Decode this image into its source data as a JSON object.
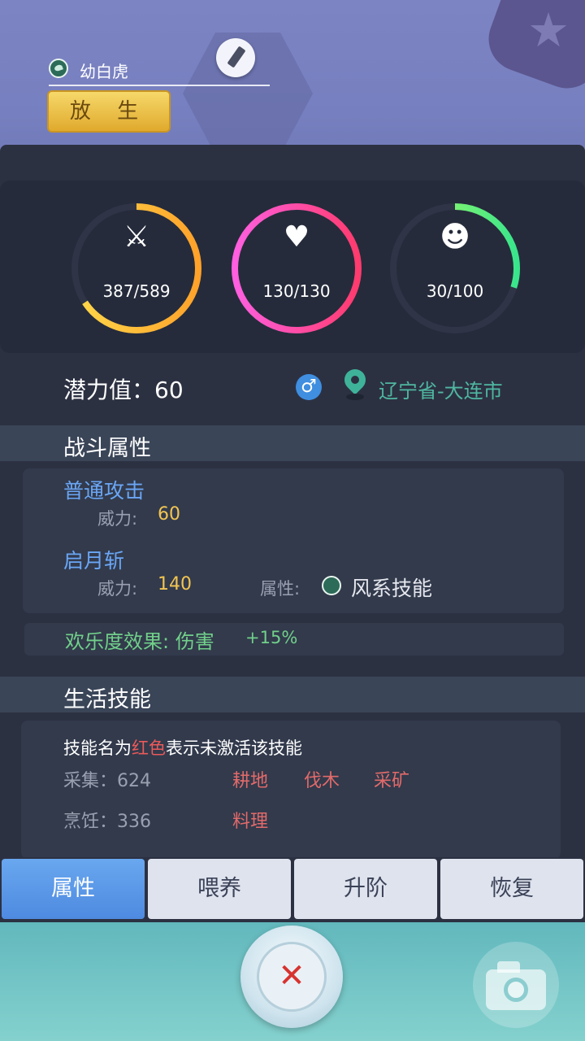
{
  "pet": {
    "name": "幼白虎",
    "release_label": "放 生"
  },
  "stats": [
    {
      "icon": "crossed-swords-icon",
      "value": "387/589",
      "fraction": 0.657,
      "color_start": "#ffa22a",
      "color_end": "#ffd84a"
    },
    {
      "icon": "heart-icon",
      "value": "130/130",
      "fraction": 1.0,
      "color_start": "#ff3b6e",
      "color_end": "#ff5fe0"
    },
    {
      "icon": "smiley-icon",
      "value": "30/100",
      "fraction": 0.3,
      "color_start": "#b4ff5a",
      "color_end": "#39e58c"
    }
  ],
  "info": {
    "potential": "潜力值：60",
    "gender_symbol": "♂",
    "location": "辽宁省-大连市"
  },
  "combat": {
    "header": "战斗属性",
    "skill1": {
      "name": "普通攻击",
      "power_label": "威力:",
      "power_value": "60"
    },
    "skill2": {
      "name": "启月斩",
      "power_label": "威力:",
      "power_value": "140",
      "attr_label": "属性:",
      "attr_value": "风系技能"
    },
    "happy_effect": "欢乐度效果:   伤害",
    "happy_value": "+15%"
  },
  "life": {
    "header": "生活技能",
    "note_prefix": "技能名为",
    "note_red": "红色",
    "note_suffix": "表示未激活该技能",
    "rows": [
      {
        "label": "采集：624",
        "skills": [
          "耕地",
          "伐木",
          "采矿"
        ]
      },
      {
        "label": "烹饪：336",
        "skills": [
          "料理"
        ]
      }
    ]
  },
  "tabs": [
    "属性",
    "喂养",
    "升阶",
    "恢复"
  ],
  "colors": {
    "accent_blue": "#5b9cf0",
    "skill_blue": "#6aa6f5",
    "power_yellow": "#f2c552",
    "happy_green": "#71d08a",
    "inactive_red": "#e26a6a"
  }
}
